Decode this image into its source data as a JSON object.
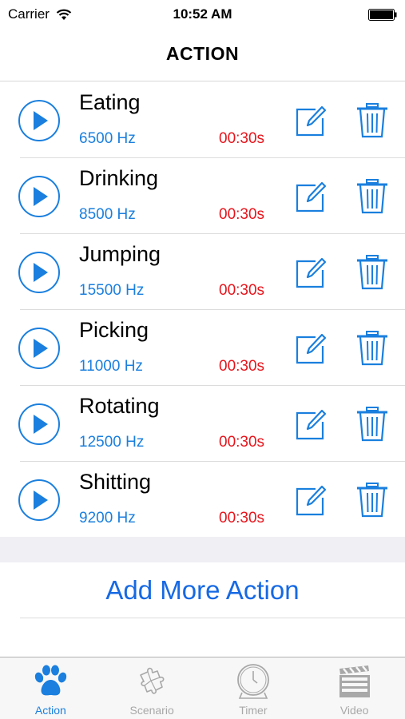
{
  "status_bar": {
    "carrier": "Carrier",
    "time": "10:52 AM"
  },
  "nav": {
    "title": "ACTION"
  },
  "actions": [
    {
      "name": "Eating",
      "frequency": "6500 Hz",
      "duration": "00:30s"
    },
    {
      "name": "Drinking",
      "frequency": "8500 Hz",
      "duration": "00:30s"
    },
    {
      "name": "Jumping",
      "frequency": "15500 Hz",
      "duration": "00:30s"
    },
    {
      "name": "Picking",
      "frequency": "11000 Hz",
      "duration": "00:30s"
    },
    {
      "name": "Rotating",
      "frequency": "12500 Hz",
      "duration": "00:30s"
    },
    {
      "name": "Shitting",
      "frequency": "9200 Hz",
      "duration": "00:30s"
    }
  ],
  "add_button": {
    "label": "Add More Action"
  },
  "tabs": [
    {
      "label": "Action",
      "icon": "paw-icon",
      "active": true
    },
    {
      "label": "Scenario",
      "icon": "puzzle-icon",
      "active": false
    },
    {
      "label": "Timer",
      "icon": "clock-icon",
      "active": false
    },
    {
      "label": "Video",
      "icon": "clapperboard-icon",
      "active": false
    }
  ],
  "colors": {
    "accent": "#1a7fde",
    "duration": "#e8141b",
    "add_button": "#1669e4",
    "tab_inactive": "#a8a8a8"
  }
}
